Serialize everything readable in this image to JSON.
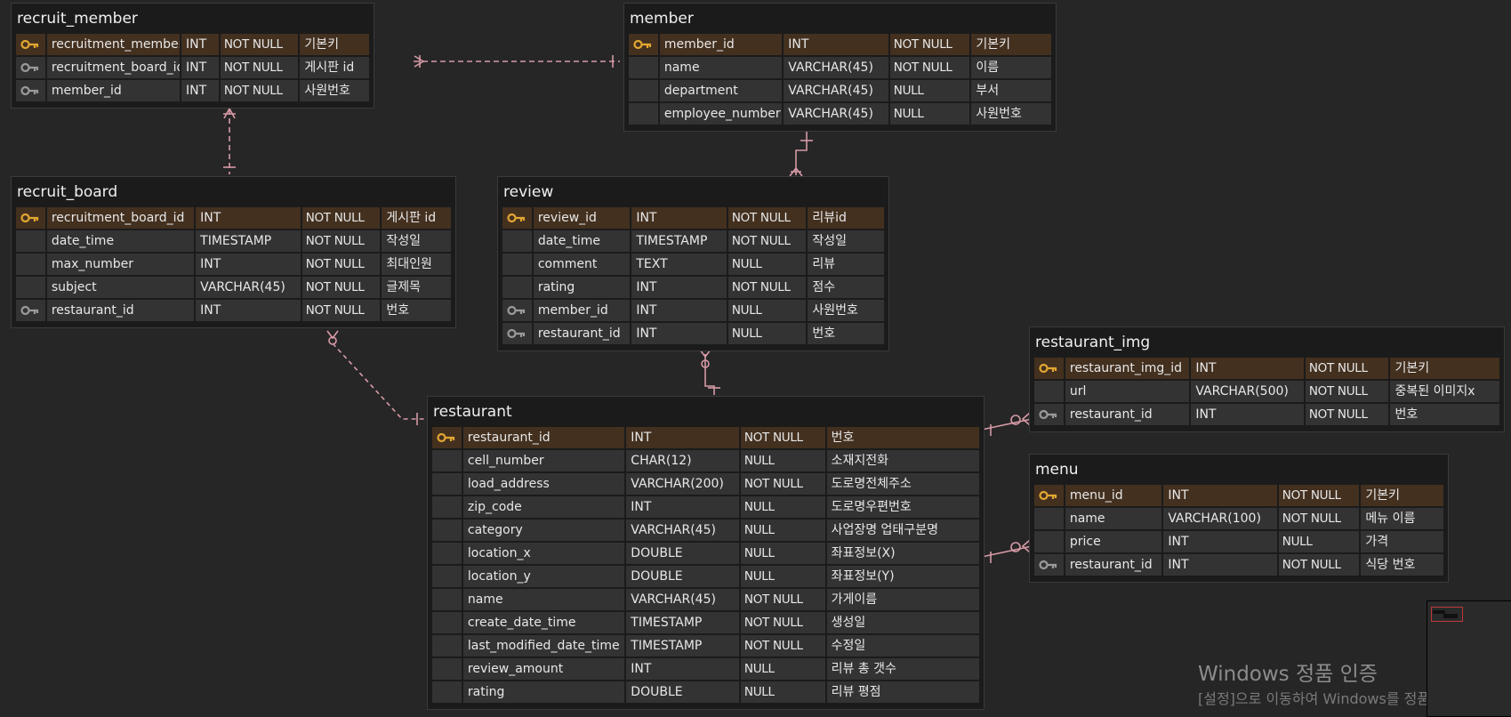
{
  "tables": [
    {
      "name": "recruit_member",
      "cols": [
        150,
        42,
        88,
        78
      ],
      "rows": [
        {
          "key": "pk",
          "cells": [
            "recruitment_member_id",
            "INT",
            "NOT NULL",
            "기본키"
          ]
        },
        {
          "key": "fk",
          "cells": [
            "recruitment_board_id",
            "INT",
            "NOT NULL",
            "게시판 id"
          ]
        },
        {
          "key": "fk",
          "cells": [
            "member_id",
            "INT",
            "NOT NULL",
            "사원번호"
          ]
        }
      ]
    },
    {
      "name": "member",
      "cols": [
        138,
        118,
        90,
        90
      ],
      "rows": [
        {
          "key": "pk",
          "cells": [
            "member_id",
            "INT",
            "NOT NULL",
            "기본키"
          ]
        },
        {
          "key": "",
          "cells": [
            "name",
            "VARCHAR(45)",
            "NOT NULL",
            "이름"
          ]
        },
        {
          "key": "",
          "cells": [
            "department",
            "VARCHAR(45)",
            "NULL",
            "부서"
          ]
        },
        {
          "key": "",
          "cells": [
            "employee_number",
            "VARCHAR(45)",
            "NULL",
            "사원번호"
          ]
        }
      ]
    },
    {
      "name": "recruit_board",
      "cols": [
        166,
        118,
        88,
        78
      ],
      "rows": [
        {
          "key": "pk",
          "cells": [
            "recruitment_board_id",
            "INT",
            "NOT NULL",
            "게시판 id"
          ]
        },
        {
          "key": "",
          "cells": [
            "date_time",
            "TIMESTAMP",
            "NOT NULL",
            "작성일"
          ]
        },
        {
          "key": "",
          "cells": [
            "max_number",
            "INT",
            "NOT NULL",
            "최대인원"
          ]
        },
        {
          "key": "",
          "cells": [
            "subject",
            "VARCHAR(45)",
            "NOT NULL",
            "글제목"
          ]
        },
        {
          "key": "fk",
          "cells": [
            "restaurant_id",
            "INT",
            "NOT NULL",
            "번호"
          ]
        }
      ]
    },
    {
      "name": "review",
      "cols": [
        109,
        107,
        88,
        86
      ],
      "rows": [
        {
          "key": "pk",
          "cells": [
            "review_id",
            "INT",
            "NOT NULL",
            "리뷰id"
          ]
        },
        {
          "key": "",
          "cells": [
            "date_time",
            "TIMESTAMP",
            "NOT NULL",
            "작성일"
          ]
        },
        {
          "key": "",
          "cells": [
            "comment",
            "TEXT",
            "NULL",
            "리뷰"
          ]
        },
        {
          "key": "",
          "cells": [
            "rating",
            "INT",
            "NOT NULL",
            "점수"
          ]
        },
        {
          "key": "fk",
          "cells": [
            "member_id",
            "INT",
            "NULL",
            "사원번호"
          ]
        },
        {
          "key": "fk",
          "cells": [
            "restaurant_id",
            "INT",
            "NULL",
            "번호"
          ]
        }
      ]
    },
    {
      "name": "restaurant",
      "cols": [
        182,
        127,
        95,
        172
      ],
      "rows": [
        {
          "key": "pk",
          "cells": [
            "restaurant_id",
            "INT",
            "NOT NULL",
            "번호"
          ]
        },
        {
          "key": "",
          "cells": [
            "cell_number",
            "CHAR(12)",
            "NULL",
            "소재지전화"
          ]
        },
        {
          "key": "",
          "cells": [
            "load_address",
            "VARCHAR(200)",
            "NOT NULL",
            "도로명전체주소"
          ]
        },
        {
          "key": "",
          "cells": [
            "zip_code",
            "INT",
            "NULL",
            "도로명우편번호"
          ]
        },
        {
          "key": "",
          "cells": [
            "category",
            "VARCHAR(45)",
            "NULL",
            "사업장명 업태구분명"
          ]
        },
        {
          "key": "",
          "cells": [
            "location_x",
            "DOUBLE",
            "NULL",
            "좌표정보(X)"
          ]
        },
        {
          "key": "",
          "cells": [
            "location_y",
            "DOUBLE",
            "NULL",
            "좌표정보(Y)"
          ]
        },
        {
          "key": "",
          "cells": [
            "name",
            "VARCHAR(45)",
            "NOT NULL",
            "가게이름"
          ]
        },
        {
          "key": "",
          "cells": [
            "create_date_time",
            "TIMESTAMP",
            "NOT NULL",
            "생성일"
          ]
        },
        {
          "key": "",
          "cells": [
            "last_modified_date_time",
            "TIMESTAMP",
            "NOT NULL",
            "수정일"
          ]
        },
        {
          "key": "",
          "cells": [
            "review_amount",
            "INT",
            "NULL",
            "리뷰 총 갯수"
          ]
        },
        {
          "key": "",
          "cells": [
            "rating",
            "DOUBLE",
            "NULL",
            "리뷰 평점"
          ]
        }
      ]
    },
    {
      "name": "restaurant_img",
      "cols": [
        140,
        127,
        94,
        123
      ],
      "rows": [
        {
          "key": "pk",
          "cells": [
            "restaurant_img_id",
            "INT",
            "NOT NULL",
            "기본키"
          ]
        },
        {
          "key": "",
          "cells": [
            "url",
            "VARCHAR(500)",
            "NOT NULL",
            "중복된 이미지x"
          ]
        },
        {
          "key": "fk",
          "cells": [
            "restaurant_id",
            "INT",
            "NOT NULL",
            "번호"
          ]
        }
      ]
    },
    {
      "name": "menu",
      "cols": [
        109,
        128,
        91,
        93
      ],
      "rows": [
        {
          "key": "pk",
          "cells": [
            "menu_id",
            "INT",
            "NOT NULL",
            "기본키"
          ]
        },
        {
          "key": "",
          "cells": [
            "name",
            "VARCHAR(100)",
            "NOT NULL",
            "메뉴 이름"
          ]
        },
        {
          "key": "",
          "cells": [
            "price",
            "INT",
            "NULL",
            "가격"
          ]
        },
        {
          "key": "fk",
          "cells": [
            "restaurant_id",
            "INT",
            "NOT NULL",
            "식당 번호"
          ]
        }
      ]
    }
  ],
  "colors": {
    "link": "#d69aa6",
    "pk_key": "#e2a632",
    "fk_key": "#9a9a9a",
    "pk_row": "#43301f",
    "cell": "#333333"
  },
  "watermark": {
    "line1": "Windows 정품 인증",
    "line2": "[설정]으로 이동하여 Windows를 정품 인증합니다."
  }
}
